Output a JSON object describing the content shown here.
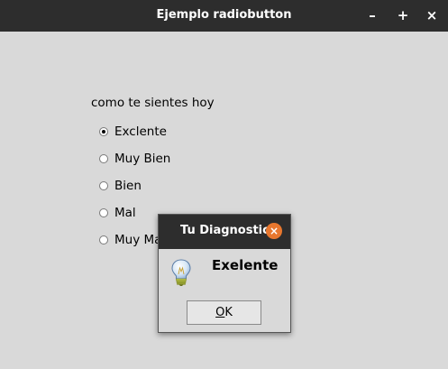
{
  "window": {
    "title": "Ejemplo radiobutton",
    "controls": {
      "minimize": "–",
      "maximize": "+",
      "close": "×"
    }
  },
  "form": {
    "question": "como te sientes hoy",
    "options": [
      {
        "label": "Exclente",
        "checked": true
      },
      {
        "label": "Muy Bien",
        "checked": false
      },
      {
        "label": "Bien",
        "checked": false
      },
      {
        "label": "Mal",
        "checked": false
      },
      {
        "label": "Muy Mal",
        "checked": false
      }
    ]
  },
  "dialog": {
    "title": "Tu Diagnostico",
    "icon": "lightbulb-icon",
    "message": "Exelente",
    "ok_mnemonic": "O",
    "ok_rest": "K",
    "close_glyph": "×"
  }
}
